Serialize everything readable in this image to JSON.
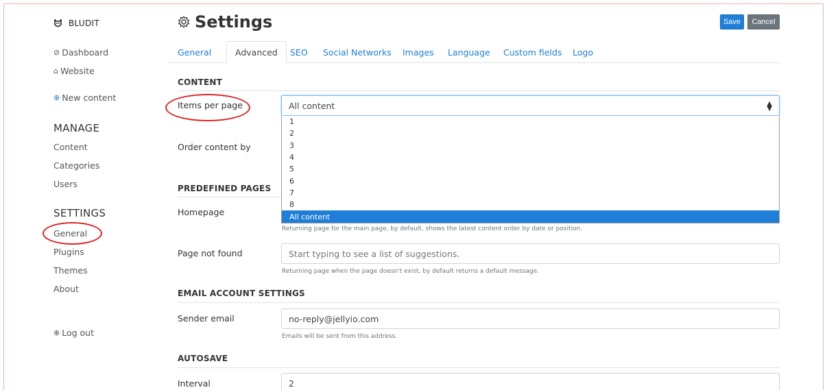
{
  "brand": {
    "name": "BLUDIT"
  },
  "sidebar": {
    "dashboard": "Dashboard",
    "website": "Website",
    "new_content": "New content",
    "manage_heading": "MANAGE",
    "manage_items": [
      "Content",
      "Categories",
      "Users"
    ],
    "settings_heading": "SETTINGS",
    "settings_items": [
      "General",
      "Plugins",
      "Themes",
      "About"
    ],
    "logout": "Log out"
  },
  "header": {
    "title": "Settings",
    "save": "Save",
    "cancel": "Cancel"
  },
  "tabs": [
    "General",
    "Advanced",
    "SEO",
    "Social Networks",
    "Images",
    "Language",
    "Custom fields",
    "Logo"
  ],
  "active_tab": "Advanced",
  "content": {
    "section": "CONTENT",
    "items_per_page_label": "Items per page",
    "items_per_page_value": "All content",
    "items_per_page_options": [
      "1",
      "2",
      "3",
      "4",
      "5",
      "6",
      "7",
      "8",
      "All content"
    ],
    "order_label": "Order content by"
  },
  "predefined": {
    "section": "PREDEFINED PAGES",
    "homepage_label": "Homepage",
    "homepage_help": "Returning page for the main page, by default, shows the latest content order by date or position.",
    "not_found_label": "Page not found",
    "not_found_placeholder": "Start typing to see a list of suggestions.",
    "not_found_help": "Returning page when the page doesn't exist, by default returns a default message."
  },
  "email": {
    "section": "EMAIL ACCOUNT SETTINGS",
    "sender_label": "Sender email",
    "sender_value": "no-reply@jellyio.com",
    "sender_help": "Emails will be sent from this address."
  },
  "autosave": {
    "section": "AUTOSAVE",
    "interval_label": "Interval",
    "interval_value": "2"
  },
  "colors": {
    "accent": "#1e7ed8",
    "annotation": "#dd2222"
  }
}
